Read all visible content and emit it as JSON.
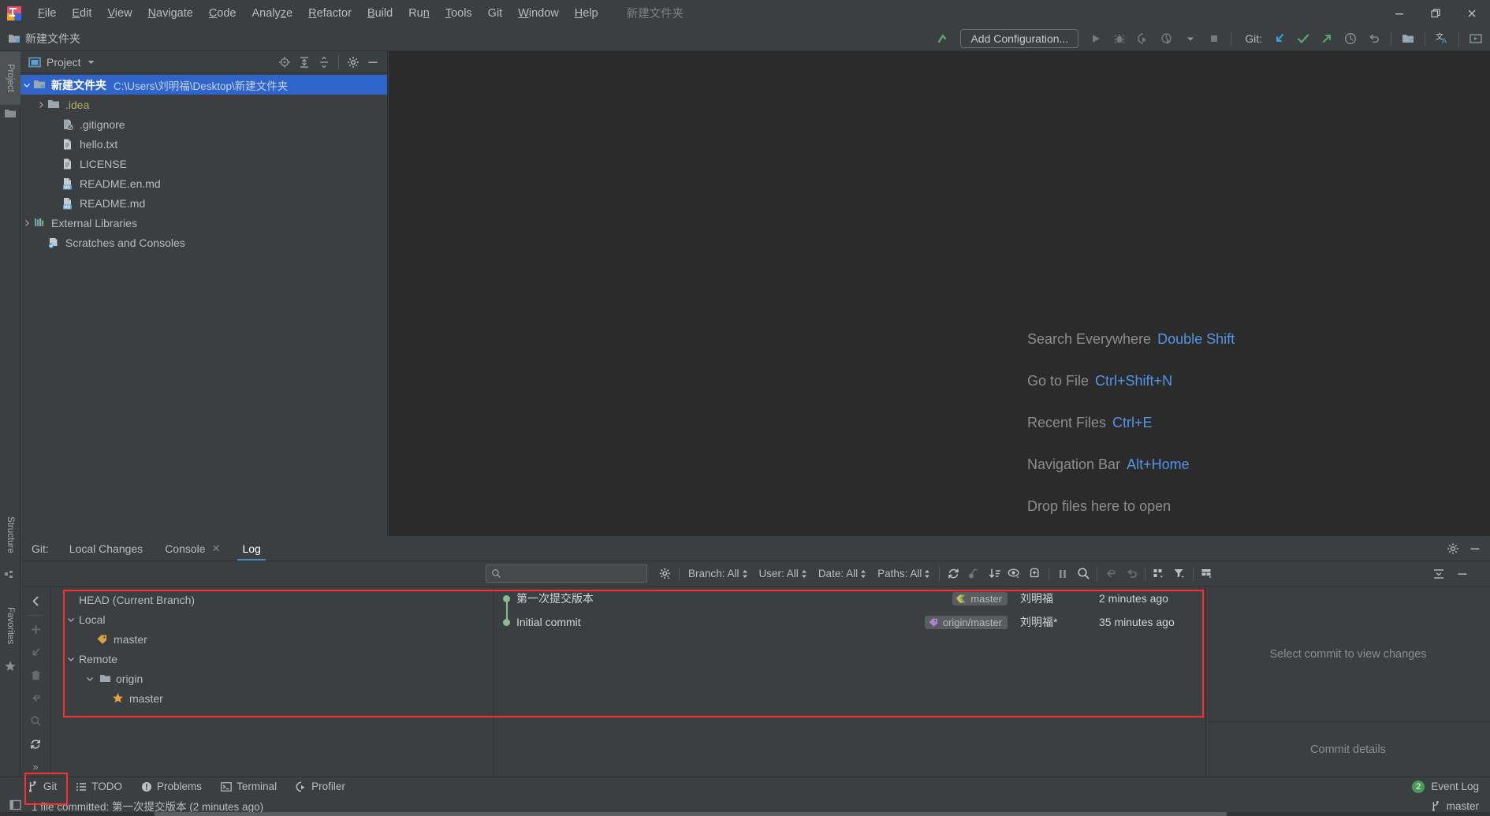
{
  "window": {
    "title": "新建文件夹",
    "controls": [
      "minimize-icon",
      "restore-icon",
      "close-icon"
    ]
  },
  "menubar": {
    "items": [
      {
        "label": "File",
        "mnemonic": "F"
      },
      {
        "label": "Edit",
        "mnemonic": "E"
      },
      {
        "label": "View",
        "mnemonic": "V"
      },
      {
        "label": "Navigate",
        "mnemonic": "N"
      },
      {
        "label": "Code",
        "mnemonic": "C"
      },
      {
        "label": "Analyze",
        "mnemonic": "z"
      },
      {
        "label": "Refactor",
        "mnemonic": "R"
      },
      {
        "label": "Build",
        "mnemonic": "B"
      },
      {
        "label": "Run",
        "mnemonic": "n"
      },
      {
        "label": "Tools",
        "mnemonic": "T"
      },
      {
        "label": "Git",
        "mnemonic": ""
      },
      {
        "label": "Window",
        "mnemonic": "W"
      },
      {
        "label": "Help",
        "mnemonic": "H"
      }
    ],
    "project_name": "新建文件夹"
  },
  "navbar": {
    "breadcrumb": "新建文件夹",
    "add_configuration": "Add Configuration...",
    "git_label": "Git:",
    "run_icons": [
      "run-icon",
      "debug-icon",
      "run-with-coverage-icon",
      "profile-icon",
      "dropdown-chevron-icon",
      "stop-icon"
    ],
    "git_icons": [
      "update-project-icon",
      "commit-icon",
      "push-icon",
      "history-icon",
      "rollback-icon"
    ],
    "trailing_icons": [
      "search-everywhere-icon",
      "project-structure-icon",
      "translate-icon",
      "presentation-icon"
    ]
  },
  "left_strip": {
    "buttons": [
      {
        "label": "Project",
        "icon": "project-icon",
        "active": true
      },
      {
        "label": "Structure",
        "icon": "structure-icon",
        "active": false
      },
      {
        "label": "Favorites",
        "icon": "star-icon",
        "active": false
      }
    ]
  },
  "project_panel": {
    "title": "Project",
    "header_icons": [
      "locate-icon",
      "expand-all-icon",
      "collapse-all-icon",
      "settings-gear-icon",
      "hide-icon"
    ],
    "tree": [
      {
        "label": "新建文件夹",
        "path": "C:\\Users\\刘明福\\Desktop\\新建文件夹",
        "icon": "module-folder-icon",
        "indent": 0,
        "chevron": "down",
        "selected": true,
        "bold": true
      },
      {
        "label": ".idea",
        "path": "",
        "icon": "folder-icon",
        "indent": 1,
        "chevron": "right",
        "selected": false,
        "dir": true
      },
      {
        "label": ".gitignore",
        "path": "",
        "icon": "gitignore-file-icon",
        "indent": 2,
        "chevron": "",
        "selected": false
      },
      {
        "label": "hello.txt",
        "path": "",
        "icon": "text-file-icon",
        "indent": 2,
        "chevron": "",
        "selected": false
      },
      {
        "label": "LICENSE",
        "path": "",
        "icon": "text-file-icon",
        "indent": 2,
        "chevron": "",
        "selected": false
      },
      {
        "label": "README.en.md",
        "path": "",
        "icon": "markdown-file-icon",
        "indent": 2,
        "chevron": "",
        "selected": false
      },
      {
        "label": "README.md",
        "path": "",
        "icon": "markdown-file-icon",
        "indent": 2,
        "chevron": "",
        "selected": false
      },
      {
        "label": "External Libraries",
        "path": "",
        "icon": "libraries-icon",
        "indent": 0,
        "chevron": "right",
        "selected": false
      },
      {
        "label": "Scratches and Consoles",
        "path": "",
        "icon": "scratches-icon",
        "indent": 1,
        "chevron": "",
        "selected": false
      }
    ]
  },
  "editor": {
    "hints": [
      {
        "action": "Search Everywhere",
        "shortcut": "Double Shift"
      },
      {
        "action": "Go to File",
        "shortcut": "Ctrl+Shift+N"
      },
      {
        "action": "Recent Files",
        "shortcut": "Ctrl+E"
      },
      {
        "action": "Navigation Bar",
        "shortcut": "Alt+Home"
      },
      {
        "action": "Drop files here to open",
        "shortcut": ""
      }
    ]
  },
  "git_window": {
    "label": "Git:",
    "tabs": [
      {
        "label": "Local Changes",
        "active": false,
        "closable": false
      },
      {
        "label": "Console",
        "active": false,
        "closable": true
      },
      {
        "label": "Log",
        "active": true,
        "closable": false
      }
    ],
    "header_icons": [
      "settings-gear-icon",
      "hide-icon"
    ],
    "toolbar": {
      "search_placeholder": "",
      "search_value": "",
      "filters": [
        {
          "label": "Branch: All"
        },
        {
          "label": "User: All"
        },
        {
          "label": "Date: All"
        },
        {
          "label": "Paths: All"
        }
      ],
      "icons": [
        "refresh-icon",
        "cherry-pick-icon",
        "sort-icon",
        "show-details-icon",
        "new-branch-icon",
        "pause-icon",
        "find-icon",
        "go-to-child-icon",
        "revert-icon",
        "group-by-icon",
        "filter-icon",
        "layout-icon",
        "collapse-icon"
      ]
    },
    "vertical_toolbar": [
      "back-icon",
      "add-icon",
      "checkout-icon",
      "delete-icon",
      "merge-icon",
      "search-icon",
      "refresh-icon",
      "more-icon"
    ],
    "branch_tree": [
      {
        "label": "HEAD (Current Branch)",
        "indent": 0,
        "chevron": "",
        "icon": ""
      },
      {
        "label": "Local",
        "indent": 0,
        "chevron": "down",
        "icon": ""
      },
      {
        "label": "master",
        "indent": 1,
        "chevron": "",
        "icon": "branch-tag-icon"
      },
      {
        "label": "Remote",
        "indent": 0,
        "chevron": "down",
        "icon": ""
      },
      {
        "label": "origin",
        "indent": 1,
        "chevron": "down",
        "icon": "folder-icon"
      },
      {
        "label": "master",
        "indent": 2,
        "chevron": "",
        "icon": "star-icon"
      }
    ],
    "commits": [
      {
        "subject": "第一次提交版本",
        "ref": "master",
        "ref_type": "local",
        "author": "刘明福",
        "date": "2 minutes ago"
      },
      {
        "subject": "Initial commit",
        "ref": "origin/master",
        "ref_type": "remote",
        "author": "刘明福*",
        "date": "35 minutes ago"
      }
    ],
    "details": {
      "changes_placeholder": "Select commit to view changes",
      "commit_details_placeholder": "Commit details"
    }
  },
  "bottom_bar": {
    "items": [
      {
        "label": "Git",
        "icon": "git-branch-icon",
        "highlighted": true
      },
      {
        "label": "TODO",
        "icon": "todo-icon",
        "highlighted": false
      },
      {
        "label": "Problems",
        "icon": "problems-icon",
        "highlighted": false
      },
      {
        "label": "Terminal",
        "icon": "terminal-icon",
        "highlighted": false
      },
      {
        "label": "Profiler",
        "icon": "profiler-icon",
        "highlighted": false
      }
    ],
    "event_log": {
      "label": "Event Log",
      "count": "2"
    }
  },
  "status_bar": {
    "message": "1 file committed: 第一次提交版本 (2 minutes ago)",
    "branch": "master"
  },
  "colors": {
    "accent_blue": "#4a88c7",
    "selection_blue": "#2f65ca",
    "shortcut_blue": "#5495e8",
    "annotation_red": "#ff2d2d",
    "green_node": "#8ebb8e",
    "dir_yellow": "#b3ae60",
    "badge_green": "#499c54"
  }
}
